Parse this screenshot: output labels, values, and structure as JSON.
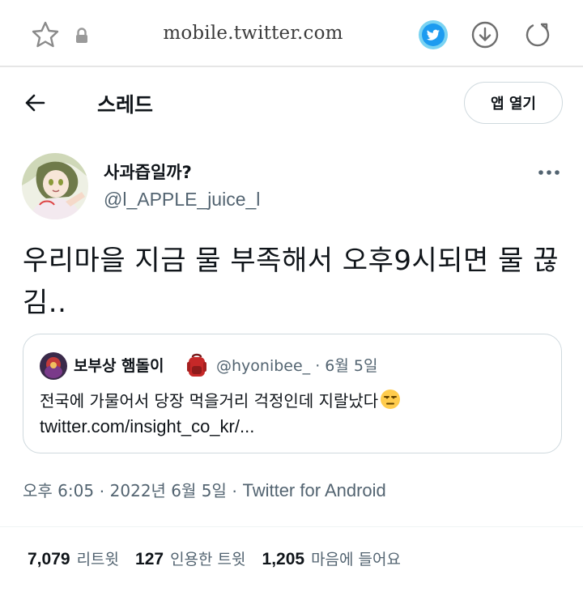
{
  "browser": {
    "url": "mobile.twitter.com"
  },
  "header": {
    "title": "스레드",
    "open_app_label": "앱 열기"
  },
  "tweet": {
    "display_name": "사과즙일까?",
    "handle": "@l_APPLE_juice_l",
    "text": "우리마을 지금 물 부족해서 오후9시되면 물 끊김..",
    "timestamp_time": "오후 6:05",
    "timestamp_sep": " · ",
    "timestamp_date": "2022년 6월 5일",
    "timestamp_sep2": " · ",
    "source": "Twitter for Android"
  },
  "quote": {
    "display_name": "보부상 햄돌이",
    "handle": "@hyonibee_",
    "date_sep": " · ",
    "date": "6월 5일",
    "text": "전국에 가물어서 당장 먹을거리 걱정인데 지랄났다",
    "link": "twitter.com/insight_co_kr/..."
  },
  "stats": {
    "retweets_count": "7,079",
    "retweets_label": "리트윗",
    "quotes_count": "127",
    "quotes_label": "인용한 트윗",
    "likes_count": "1,205",
    "likes_label": "마음에 들어요"
  },
  "colors": {
    "text_primary": "#0f1419",
    "text_secondary": "#536471",
    "border": "#cfd9de",
    "twitter_blue": "#1d9bf0"
  }
}
